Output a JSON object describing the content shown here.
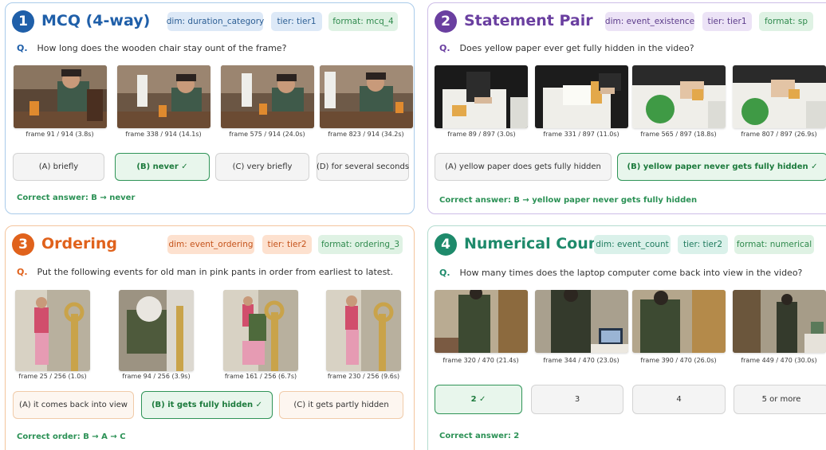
{
  "colors": {
    "blue": "#1f5fa9",
    "purple": "#6a3fa0",
    "orange": "#e0621c",
    "teal": "#1e8a6b",
    "correct": "#2b9155"
  },
  "panels": {
    "mcq": {
      "number": "1",
      "title": "MCQ (4-way)",
      "tags": [
        "dim: duration_category",
        "tier: tier1",
        "format: mcq_4"
      ],
      "q_marker": "Q.",
      "question": "How long does the wooden chair stay ount of the frame?",
      "frames": [
        "frame 91 / 914   (3.8s)",
        "frame 338 / 914   (14.1s)",
        "frame 575 / 914   (24.0s)",
        "frame 823 / 914   (34.2s)"
      ],
      "options": [
        "(A) briefly",
        "(B) never  ✓",
        "(C) very briefly",
        "(D) for several seconds"
      ],
      "answer": "Correct answer:   B → never"
    },
    "sp": {
      "number": "2",
      "title": "Statement Pair",
      "tags": [
        "dim: event_existence",
        "tier: tier1",
        "format: sp"
      ],
      "q_marker": "Q.",
      "question": "Does yellow paper ever get fully hidden in the video?",
      "frames": [
        "frame 89 / 897   (3.0s)",
        "frame 331 / 897   (11.0s)",
        "frame 565 / 897   (18.8s)",
        "frame 807 / 897   (26.9s)"
      ],
      "options": [
        "(A) yellow paper does gets fully hidden",
        "(B) yellow paper never gets fully hidden  ✓"
      ],
      "answer": "Correct answer:   B  →  yellow paper never gets fully hidden"
    },
    "ordering": {
      "number": "3",
      "title": "Ordering",
      "tags": [
        "dim: event_ordering",
        "tier: tier2",
        "format: ordering_3"
      ],
      "q_marker": "Q.",
      "question": "Put the following events for old man in pink pants in order from earliest to latest.",
      "frames": [
        "frame 25 / 256   (1.0s)",
        "frame 94 / 256   (3.9s)",
        "frame 161 / 256   (6.7s)",
        "frame 230 / 256   (9.6s)"
      ],
      "options": [
        "(A) it comes back into view",
        "(B) it gets fully hidden  ✓",
        "(C) it gets partly hidden"
      ],
      "answer": "Correct order:   B → A → C"
    },
    "count": {
      "number": "4",
      "title": "Numerical Count",
      "tags": [
        "dim: event_count",
        "tier: tier2",
        "format: numerical"
      ],
      "q_marker": "Q.",
      "question": "How many times does the laptop computer come back into view in the video?",
      "frames": [
        "frame 320 / 470   (21.4s)",
        "frame 344 / 470   (23.0s)",
        "frame 390 / 470   (26.0s)",
        "frame 449 / 470   (30.0s)"
      ],
      "options": [
        "2  ✓",
        "3",
        "4",
        "5 or more"
      ],
      "answer": "Correct answer:   2"
    }
  }
}
